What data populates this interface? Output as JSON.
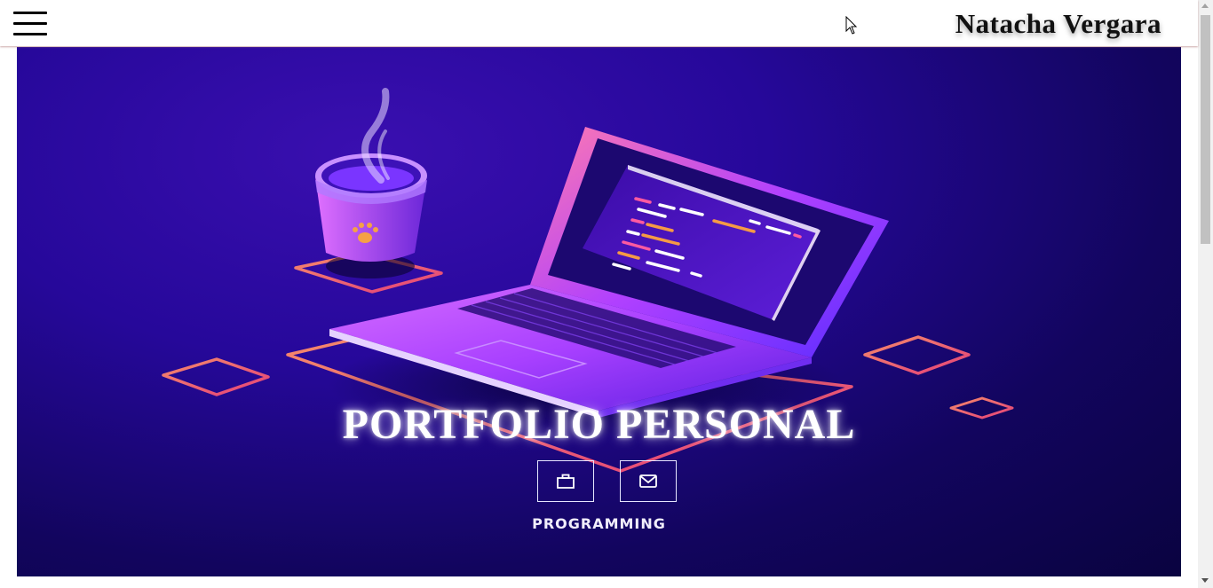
{
  "header": {
    "menu_icon": "hamburger-icon",
    "brand": "Natacha Vergara"
  },
  "hero": {
    "title": "PORTFOLIO PERSONAL",
    "subtitle": "PROGRAMMING",
    "buttons": [
      {
        "icon": "briefcase-icon"
      },
      {
        "icon": "mail-icon"
      }
    ],
    "illustration": "isometric-laptop-and-coffee-cup",
    "colors": {
      "background_dark": "#0a0340",
      "background_light": "#3a0fb0",
      "accent_orange": "#f58a6a",
      "accent_pink": "#e4407a",
      "accent_purple": "#9b38ff"
    }
  },
  "scrollbar": {
    "icon_up": "arrow-up-icon",
    "icon_down": "arrow-down-icon"
  }
}
